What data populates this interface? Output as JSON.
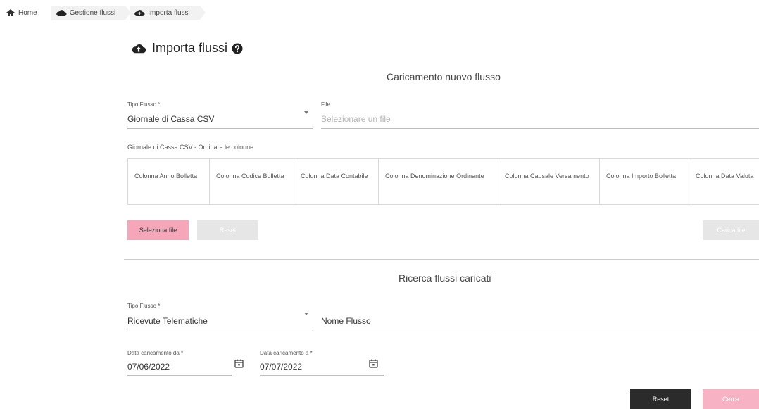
{
  "breadcrumb": {
    "home": "Home",
    "gestione": "Gestione flussi",
    "importa": "Importa flussi"
  },
  "page": {
    "title": "Importa flussi"
  },
  "upload": {
    "section_title": "Caricamento nuovo flusso",
    "tipo_label": "Tipo Flusso *",
    "tipo_value": "Giornale di Cassa CSV",
    "file_label": "File",
    "file_placeholder": "Selezionare un file",
    "order_hint": "Giornale di Cassa CSV - Ordinare le colonne",
    "columns": [
      "Colonna Anno Bolletta",
      "Colonna Codice Bolletta",
      "Colonna Data Contabile",
      "Colonna Denominazione Ordinante",
      "Colonna Causale Versamento",
      "Colonna Importo Bolletta",
      "Colonna Data Valuta"
    ],
    "select_file_label": "Seleziona file",
    "reset_label": "Reset",
    "upload_label": "Carica file"
  },
  "search": {
    "section_title": "Ricerca flussi caricati",
    "tipo_label": "Tipo Flusso *",
    "tipo_value": "Ricevute Telematiche",
    "nome_placeholder": "Nome Flusso",
    "da_label": "Data caricamento da *",
    "da_value": "07/06/2022",
    "a_label": "Data caricamento a *",
    "a_value": "07/07/2022",
    "reset_label": "Reset",
    "search_label": "Cerca"
  }
}
